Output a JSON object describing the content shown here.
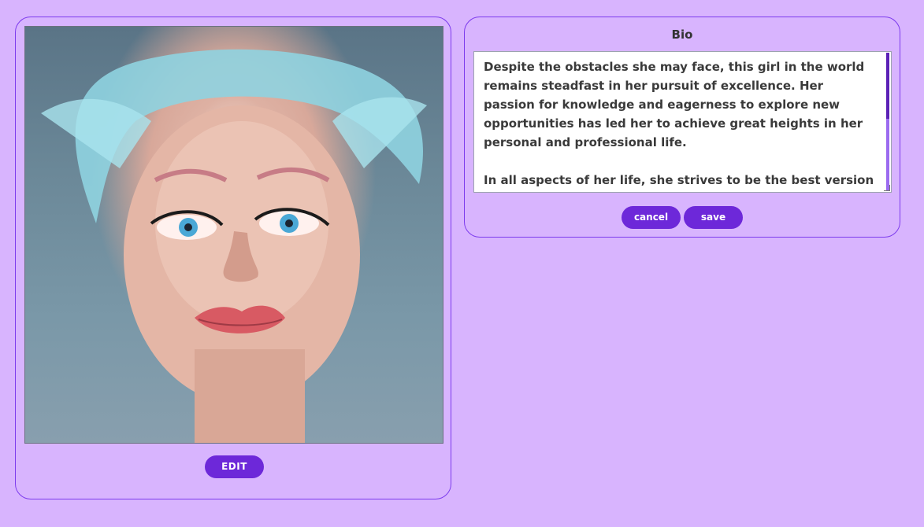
{
  "image_card": {
    "portrait_alt": "",
    "edit_label": "EDIT"
  },
  "bio_card": {
    "title": "Bio",
    "text": "Despite the obstacles she may face, this girl in the world remains steadfast in her pursuit of excellence. Her passion for knowledge and eagerness to explore new opportunities has led her to achieve great heights in her personal and professional life.\n\nIn all aspects of her life, she strives to be the best version of herself, never settling for mediocrity. With her infectious energy and unwavering determination, she continues to inspire those around her.",
    "cancel_label": "cancel",
    "save_label": "save"
  },
  "colors": {
    "background": "#d8b4fe",
    "accent": "#6d28d9",
    "border": "#7c3aed"
  }
}
